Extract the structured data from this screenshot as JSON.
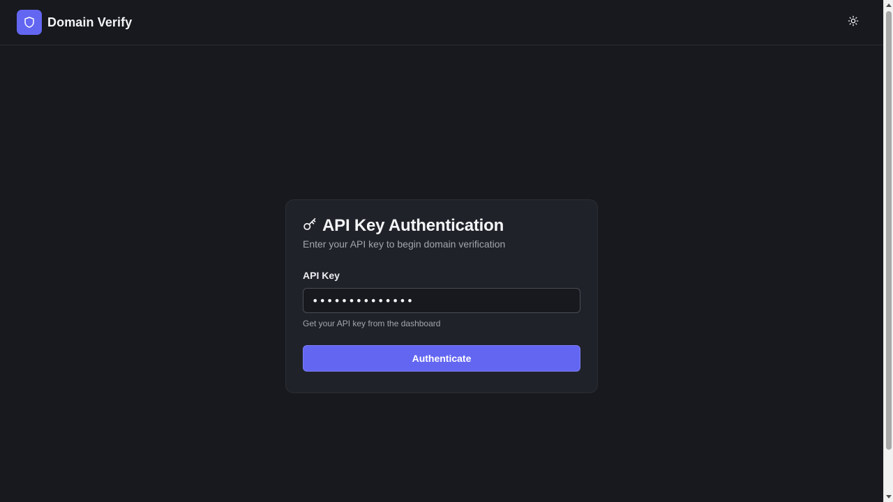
{
  "app": {
    "name": "Domain Verify",
    "logo_icon": "shield-icon",
    "theme_toggle_icon": "sun-icon",
    "accent_color": "#6366f1",
    "background_color": "#18191e"
  },
  "auth_card": {
    "title_icon": "key-icon",
    "title": "API Key Authentication",
    "subtitle": "Enter your API key to begin domain verification",
    "api_key_label": "API Key",
    "api_key_value": "sk_live_abcdef",
    "api_key_masked_length": 14,
    "hint": "Get your API key from the dashboard",
    "submit_label": "Authenticate"
  }
}
